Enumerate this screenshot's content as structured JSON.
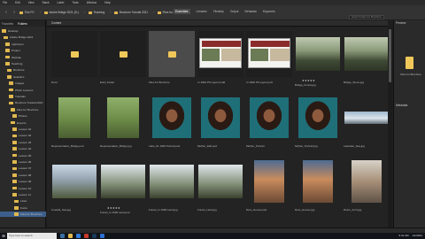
{
  "menubar": [
    "File",
    "Edit",
    "View",
    "Stack",
    "Label",
    "Tools",
    "Window",
    "Help"
  ],
  "path": [
    "This PC",
    "Adobe Bridge 2021 (D:)",
    "Teaching",
    "Brochure Tutorial 2021",
    "Files for Brochure"
  ],
  "workspaces": [
    {
      "label": "Essentials",
      "active": true
    },
    {
      "label": "Libraries",
      "active": false
    },
    {
      "label": "Filmstrip",
      "active": false
    },
    {
      "label": "Output",
      "active": false
    },
    {
      "label": "Metadata",
      "active": false
    },
    {
      "label": "Keywords",
      "active": false
    }
  ],
  "search_placeholder": "Search Files for Brochure",
  "left_tabs": [
    "Favorites",
    "Folders"
  ],
  "folders": [
    "Desktop",
    "Adobe Bridge 2021",
    "Lightroom",
    "Project",
    "Website",
    "Teaching",
    "Brochure",
    "Graphics",
    "Images",
    "Photo Lessons",
    "Tutorials",
    "Brochure Tutorial 2021",
    "Files for Brochure",
    "Photos",
    "Exports",
    "Lesson 01",
    "Lesson 02",
    "Lesson 03",
    "Lesson 04",
    "Lesson 05",
    "Lesson 06",
    "Lesson 07",
    "Lesson 08",
    "Lesson 09",
    "Lesson 10",
    "Lesson 11",
    "Links",
    "Fonts",
    "Files for Brochure"
  ],
  "content_tab": "Content",
  "items": [
    {
      "type": "folder",
      "name": "Docs"
    },
    {
      "type": "folder",
      "name": "Entry Folder"
    },
    {
      "type": "folder",
      "name": "Files for Brochure",
      "selected": true
    },
    {
      "type": "brochure",
      "name": "In 1000 PS Layout.indd"
    },
    {
      "type": "brochure",
      "name": "In 1000 PS Layout.pdf"
    },
    {
      "type": "forest",
      "name": "Bridge_Forest.jpg",
      "rating": "★★★★★"
    },
    {
      "type": "forest",
      "name": "Bridge_Stone.jpg"
    },
    {
      "type": "bridge",
      "name": "Representation_Bridge.psd"
    },
    {
      "type": "bridge",
      "name": "Representation_Bridge.jpg"
    },
    {
      "type": "portrait",
      "name": "Indie_01 1000 Portrait.psd"
    },
    {
      "type": "portrait",
      "name": "Mother_Edit.psd"
    },
    {
      "type": "portrait",
      "name": "Mother_Portrait"
    },
    {
      "type": "portrait",
      "name": "Mother_Portrait.jpg"
    },
    {
      "type": "sky",
      "name": "Lakeside_Sea.jpg"
    },
    {
      "type": "cliff",
      "name": "Coastal_Sea.jpg"
    },
    {
      "type": "tree",
      "name": "Forest_In 1000 Land.psd",
      "rating": "★★★★★"
    },
    {
      "type": "tree",
      "name": "Forest_In 1000 Land.jpg"
    },
    {
      "type": "tree",
      "name": "Forest_Land.jpg"
    },
    {
      "type": "dam",
      "name": "Dam_Hoover.psd"
    },
    {
      "type": "dam",
      "name": "Dam_Hoover.jpg"
    },
    {
      "type": "ruin",
      "name": "Ruins_Arch.jpg"
    }
  ],
  "right_panels": {
    "preview": "Preview",
    "metadata": "Metadata"
  },
  "preview_caption": "Files for Brochure",
  "taskbar": {
    "search_placeholder": "Type here to search",
    "time": "9:41 AM",
    "date": "1/1/2021"
  },
  "colors": {
    "accent": "#3d5f8c",
    "folder": "#f0c85a",
    "panel": "#2a2a2a"
  }
}
